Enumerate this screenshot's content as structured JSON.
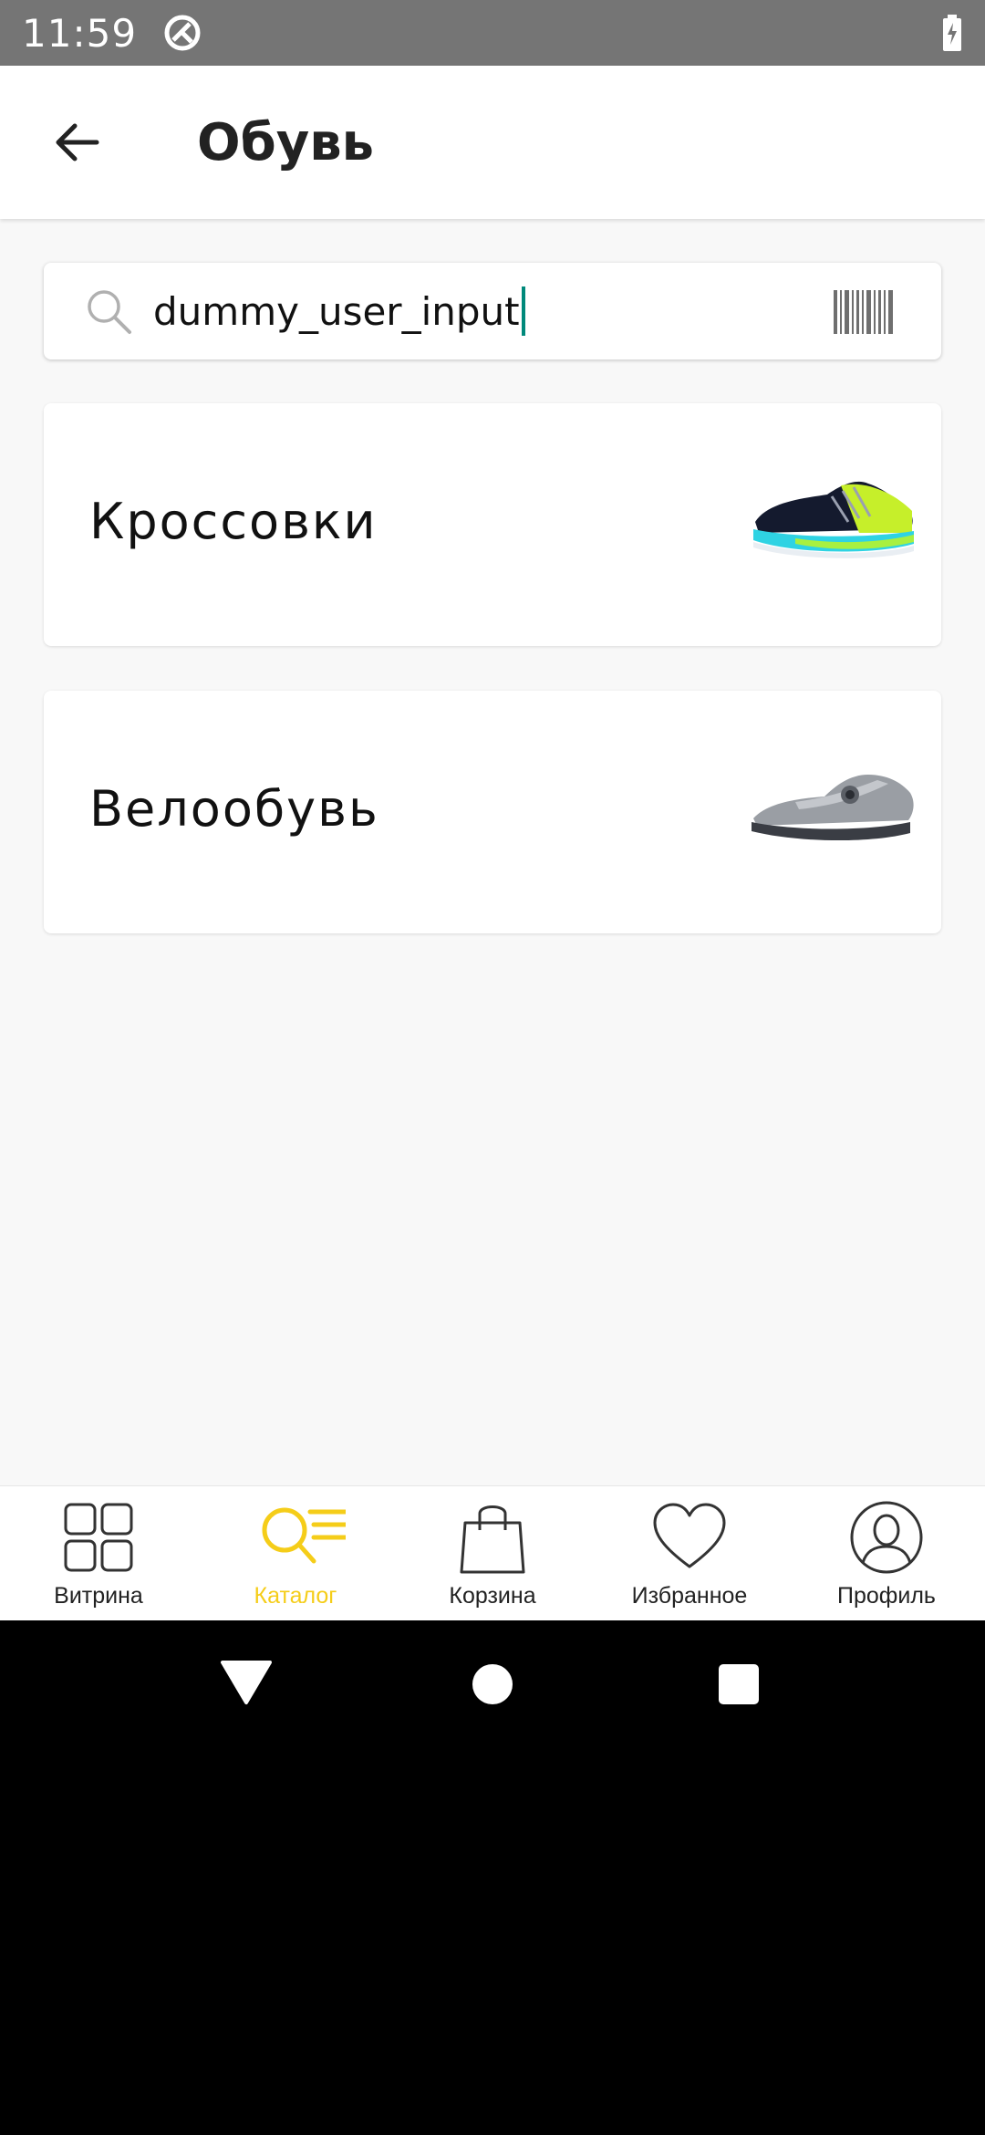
{
  "status_bar": {
    "time": "11:59",
    "app_icon": "notification-app-icon",
    "battery_icon": "battery-charging-icon"
  },
  "app_bar": {
    "title": "Обувь",
    "back_icon": "arrow-left-icon"
  },
  "search": {
    "value": "dummy_user_input",
    "icon": "search-icon",
    "scan_icon": "barcode-icon",
    "caret_color": "#00897b"
  },
  "categories": [
    {
      "label": "Кроссовки",
      "image": "running-shoe-image"
    },
    {
      "label": "Велообувь",
      "image": "cycling-shoe-image"
    }
  ],
  "bottom_nav": {
    "active_color": "#f5cd19",
    "items": [
      {
        "label": "Витрина",
        "icon": "grid-icon",
        "active": false
      },
      {
        "label": "Каталог",
        "icon": "catalog-search-icon",
        "active": true
      },
      {
        "label": "Корзина",
        "icon": "shopping-bag-icon",
        "active": false
      },
      {
        "label": "Избранное",
        "icon": "heart-icon",
        "active": false
      },
      {
        "label": "Профиль",
        "icon": "profile-icon",
        "active": false
      }
    ]
  },
  "system_nav": {
    "back": "triangle-back-icon",
    "home": "circle-home-icon",
    "recents": "square-recents-icon"
  }
}
